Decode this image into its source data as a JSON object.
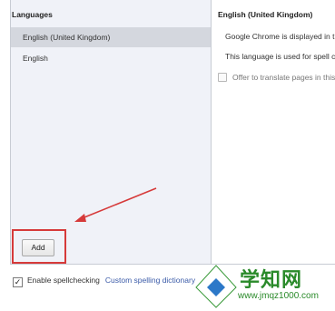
{
  "languages_panel": {
    "header": "Languages",
    "items": [
      {
        "label": "English (United Kingdom)",
        "selected": true
      },
      {
        "label": "English",
        "selected": false
      }
    ],
    "add_button_label": "Add"
  },
  "detail_panel": {
    "header": "English (United Kingdom)",
    "display_text": "Google Chrome is displayed in t",
    "spellcheck_text": "This language is used for spell c",
    "translate_label": "Offer to translate pages in this"
  },
  "footer": {
    "spellcheck_label": "Enable spellchecking",
    "spellcheck_checked": true,
    "custom_dictionary_link": "Custom spelling dictionary"
  },
  "watermark": {
    "title": "学知网",
    "url": "www.jmqz1000.com"
  },
  "colors": {
    "highlight": "#d63a3a",
    "link": "#3b5ba8",
    "selected_bg": "#d4d7de"
  }
}
